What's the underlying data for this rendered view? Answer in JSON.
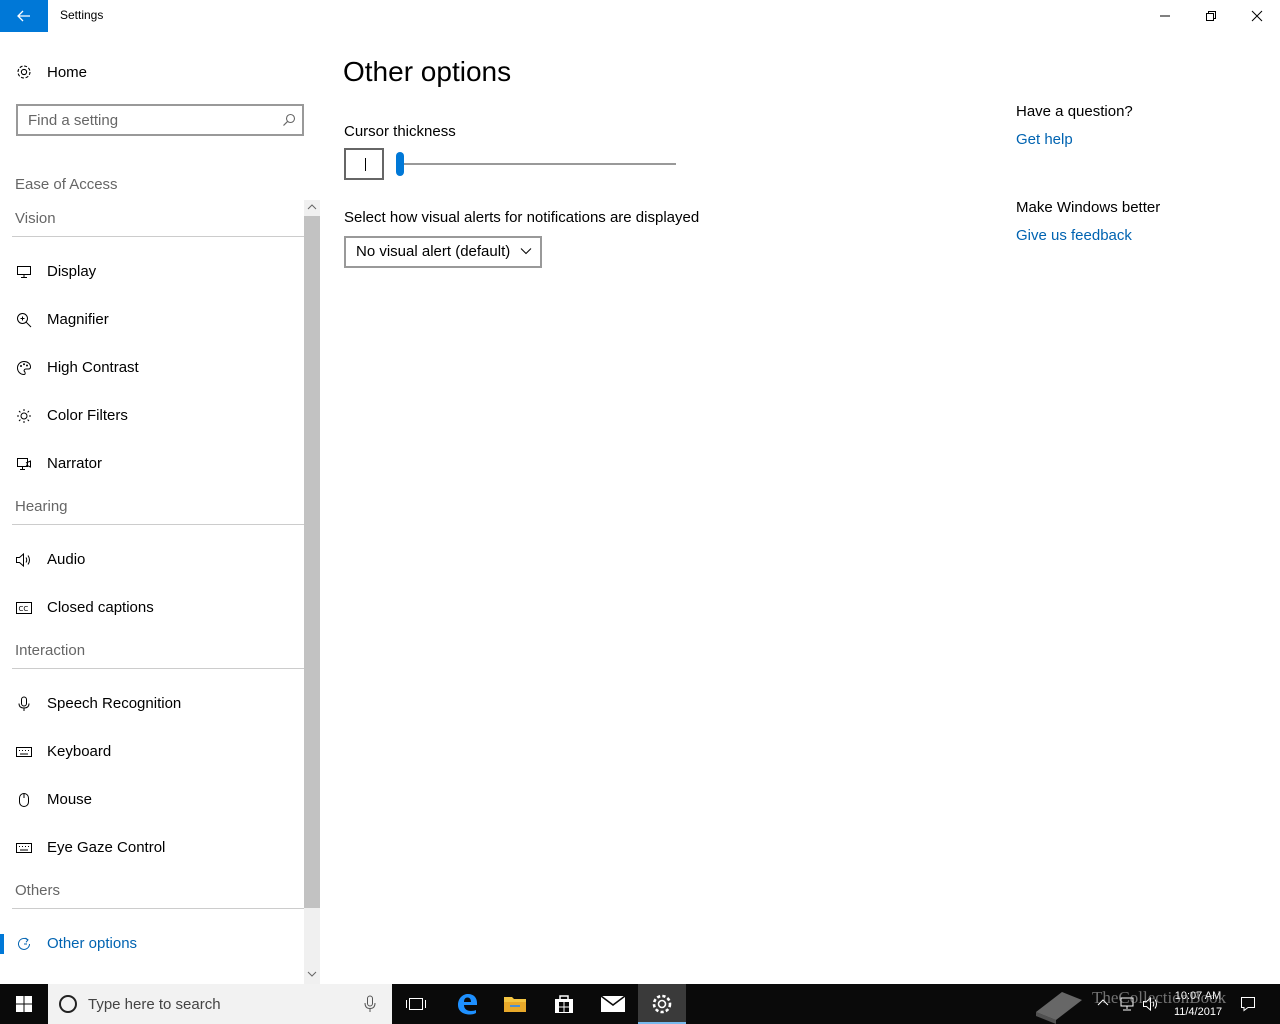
{
  "window": {
    "title": "Settings",
    "controls": [
      "minimize-icon",
      "restore-icon",
      "close-icon"
    ]
  },
  "sidebar": {
    "home_label": "Home",
    "search_placeholder": "Find a setting",
    "breadcrumb": "Ease of Access",
    "sections": [
      {
        "header": "Vision",
        "items": [
          {
            "label": "Display",
            "icon": "monitor-icon"
          },
          {
            "label": "Magnifier",
            "icon": "magnifier-icon"
          },
          {
            "label": "High Contrast",
            "icon": "palette-icon"
          },
          {
            "label": "Color Filters",
            "icon": "sun-icon"
          },
          {
            "label": "Narrator",
            "icon": "narrator-icon"
          }
        ]
      },
      {
        "header": "Hearing",
        "items": [
          {
            "label": "Audio",
            "icon": "speaker-icon"
          },
          {
            "label": "Closed captions",
            "icon": "cc-icon"
          }
        ]
      },
      {
        "header": "Interaction",
        "items": [
          {
            "label": "Speech Recognition",
            "icon": "microphone-icon"
          },
          {
            "label": "Keyboard",
            "icon": "keyboard-icon"
          },
          {
            "label": "Mouse",
            "icon": "mouse-icon"
          },
          {
            "label": "Eye Gaze Control",
            "icon": "keyboard-icon"
          }
        ]
      },
      {
        "header": "Others",
        "items": [
          {
            "label": "Other options",
            "icon": "refresh-icon",
            "active": true
          }
        ]
      }
    ]
  },
  "main": {
    "title": "Other options",
    "cursor_thickness": {
      "label": "Cursor thickness",
      "value_fraction": 0.0
    },
    "visual_alerts": {
      "label": "Select how visual alerts for notifications are displayed",
      "selected": "No visual alert (default)"
    }
  },
  "rail": {
    "question_heading": "Have a question?",
    "help_link": "Get help",
    "better_heading": "Make Windows better",
    "feedback_link": "Give us feedback"
  },
  "taskbar": {
    "search_placeholder": "Type here to search",
    "pinned": [
      "task-view-icon",
      "edge-icon",
      "file-explorer-icon",
      "store-icon",
      "mail-icon",
      "settings-icon"
    ],
    "active_app": "settings-icon",
    "clock_time": "10:07 AM",
    "clock_date": "11/4/2017"
  },
  "watermark": {
    "text": "TheCollectionBook"
  },
  "colors": {
    "accent": "#0078d7",
    "link": "#0063b1",
    "taskbar": "#0a0a0a"
  }
}
